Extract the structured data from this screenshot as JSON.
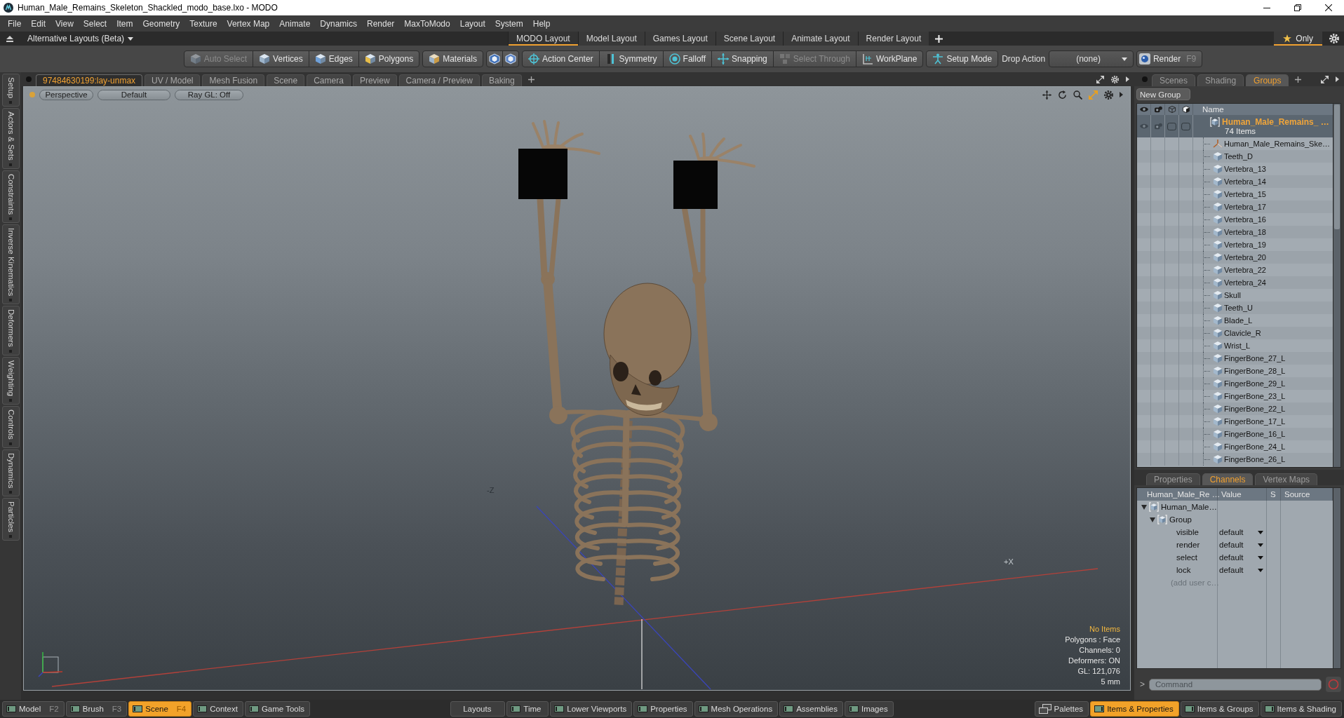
{
  "window": {
    "title": "Human_Male_Remains_Skeleton_Shackled_modo_base.lxo - MODO"
  },
  "menu": [
    "File",
    "Edit",
    "View",
    "Select",
    "Item",
    "Geometry",
    "Texture",
    "Vertex Map",
    "Animate",
    "Dynamics",
    "Render",
    "MaxToModo",
    "Layout",
    "System",
    "Help"
  ],
  "layout_bar": {
    "switcher": "Alternative Layouts (Beta)",
    "tabs": [
      {
        "label": "MODO Layout",
        "selected": true
      },
      {
        "label": "Model Layout",
        "selected": false
      },
      {
        "label": "Games Layout",
        "selected": false
      },
      {
        "label": "Scene Layout",
        "selected": false
      },
      {
        "label": "Animate Layout",
        "selected": false
      },
      {
        "label": "Render Layout",
        "selected": false
      }
    ],
    "filter": {
      "label": "Only",
      "selected": true
    }
  },
  "toolbar": {
    "groups": [
      [
        {
          "kind": "labeled",
          "label": "Auto Select",
          "disabled": true
        },
        {
          "kind": "labeled",
          "label": "Vertices",
          "disabled": false
        },
        {
          "kind": "labeled",
          "label": "Edges",
          "disabled": false
        },
        {
          "kind": "labeled",
          "label": "Polygons",
          "disabled": false
        }
      ],
      [
        {
          "kind": "labeled",
          "label": "Materials",
          "disabled": false
        }
      ],
      [
        {
          "kind": "icon",
          "disabled": false
        },
        {
          "kind": "icon",
          "disabled": false
        }
      ],
      [
        {
          "kind": "labeled",
          "label": "Action Center",
          "disabled": false
        },
        {
          "kind": "labeled",
          "label": "Symmetry",
          "disabled": false
        },
        {
          "kind": "labeled",
          "label": "Falloff",
          "disabled": false
        },
        {
          "kind": "labeled",
          "label": "Snapping",
          "disabled": false
        },
        {
          "kind": "labeled",
          "label": "Select Through",
          "disabled": true
        },
        {
          "kind": "labeled",
          "label": "WorkPlane",
          "disabled": false
        }
      ],
      [
        {
          "kind": "labeled",
          "label": "Setup Mode",
          "disabled": false
        }
      ]
    ],
    "drop_action": {
      "label": "Drop Action",
      "value": "(none)"
    },
    "render": {
      "label": "Render",
      "shortcut": "F9"
    }
  },
  "side_tabs": [
    "Setup",
    "Actors & Sets",
    "Constraints",
    "Inverse Kinematics",
    "Deformers",
    "Weighting",
    "Controls",
    "Dynamics",
    "Particles"
  ],
  "viewport_tabs": [
    {
      "label": "97484630199:lay-unmax",
      "selected": true
    },
    {
      "label": "UV / Model",
      "selected": false
    },
    {
      "label": "Mesh Fusion",
      "selected": false
    },
    {
      "label": "Scene",
      "selected": false
    },
    {
      "label": "Camera",
      "selected": false
    },
    {
      "label": "Preview",
      "selected": false
    },
    {
      "label": "Camera / Preview",
      "selected": false
    },
    {
      "label": "Baking",
      "selected": false
    }
  ],
  "viewport": {
    "view": "Perspective",
    "style": "Default",
    "ray_gl": "Ray GL: Off",
    "axis_labels": [
      "-Z",
      "+X"
    ],
    "info": {
      "selection": "No Items",
      "lines": [
        "Polygons : Face",
        "Channels: 0",
        "Deformers: ON",
        "GL: 121,076",
        "5 mm"
      ]
    }
  },
  "groups_panel": {
    "tabs": [
      {
        "label": "Scenes",
        "selected": false
      },
      {
        "label": "Shading",
        "selected": false
      },
      {
        "label": "Groups",
        "selected": true
      }
    ],
    "new_group": "New Group",
    "name_column": "Name",
    "group": {
      "name": "Human_Male_Remains_ …",
      "count": "74 Items",
      "children": [
        {
          "name": "Human_Male_Remains_Ske…",
          "kind": "locator"
        },
        {
          "name": "Teeth_D",
          "kind": "mesh"
        },
        {
          "name": "Vertebra_13",
          "kind": "mesh"
        },
        {
          "name": "Vertebra_14",
          "kind": "mesh"
        },
        {
          "name": "Vertebra_15",
          "kind": "mesh"
        },
        {
          "name": "Vertebra_17",
          "kind": "mesh"
        },
        {
          "name": "Vertebra_16",
          "kind": "mesh"
        },
        {
          "name": "Vertebra_18",
          "kind": "mesh"
        },
        {
          "name": "Vertebra_19",
          "kind": "mesh"
        },
        {
          "name": "Vertebra_20",
          "kind": "mesh"
        },
        {
          "name": "Vertebra_22",
          "kind": "mesh"
        },
        {
          "name": "Vertebra_24",
          "kind": "mesh"
        },
        {
          "name": "Skull",
          "kind": "mesh"
        },
        {
          "name": "Teeth_U",
          "kind": "mesh"
        },
        {
          "name": "Blade_L",
          "kind": "mesh"
        },
        {
          "name": "Clavicle_R",
          "kind": "mesh"
        },
        {
          "name": "Wrist_L",
          "kind": "mesh"
        },
        {
          "name": "FingerBone_27_L",
          "kind": "mesh"
        },
        {
          "name": "FingerBone_28_L",
          "kind": "mesh"
        },
        {
          "name": "FingerBone_29_L",
          "kind": "mesh"
        },
        {
          "name": "FingerBone_23_L",
          "kind": "mesh"
        },
        {
          "name": "FingerBone_22_L",
          "kind": "mesh"
        },
        {
          "name": "FingerBone_17_L",
          "kind": "mesh"
        },
        {
          "name": "FingerBone_16_L",
          "kind": "mesh"
        },
        {
          "name": "FingerBone_24_L",
          "kind": "mesh"
        },
        {
          "name": "FingerBone_26_L",
          "kind": "mesh"
        }
      ]
    }
  },
  "channels_panel": {
    "tabs": [
      {
        "label": "Properties",
        "selected": false
      },
      {
        "label": "Channels",
        "selected": true
      },
      {
        "label": "Vertex Maps",
        "selected": false
      }
    ],
    "columns": [
      "Human_Male_Re …",
      "Value",
      "S",
      "Source"
    ],
    "tree": {
      "name": "Human_Male…",
      "expanded": true,
      "children": [
        {
          "name": "Group",
          "expanded": true,
          "children": [
            {
              "name": "visible",
              "kind": "channel",
              "value": "default"
            },
            {
              "name": "render",
              "kind": "channel",
              "value": "default"
            },
            {
              "name": "select",
              "kind": "channel",
              "value": "default"
            },
            {
              "name": "lock",
              "kind": "channel",
              "value": "default"
            },
            {
              "name": "(add user c…",
              "kind": "add"
            }
          ]
        }
      ]
    }
  },
  "command": {
    "prompt": ">",
    "placeholder": "Command"
  },
  "bottom_bar": {
    "left": [
      {
        "label": "Model",
        "shortcut": "F2",
        "selected": false
      },
      {
        "label": "Brush",
        "shortcut": "F3",
        "selected": false
      },
      {
        "label": "Scene",
        "shortcut": "F4",
        "selected": true
      },
      {
        "label": "Context",
        "selected": false
      },
      {
        "label": "Game Tools",
        "selected": false
      }
    ],
    "center": [
      {
        "kind": "text",
        "label": "Layouts",
        "selected": false
      },
      {
        "kind": "panel",
        "label": "Time",
        "selected": false
      },
      {
        "kind": "panel",
        "label": "Lower Viewports",
        "selected": false
      },
      {
        "kind": "panel",
        "label": "Properties",
        "selected": false
      },
      {
        "kind": "panel",
        "label": "Mesh Operations",
        "selected": false
      },
      {
        "kind": "panel",
        "label": "Assemblies",
        "selected": false
      },
      {
        "kind": "panel",
        "label": "Images",
        "selected": false
      }
    ],
    "right": [
      {
        "kind": "palettes",
        "label": "Palettes",
        "selected": false
      },
      {
        "kind": "panel",
        "label": "Items & Properties",
        "selected": true
      },
      {
        "kind": "panel",
        "label": "Items & Groups",
        "selected": false
      },
      {
        "kind": "panel",
        "label": "Items & Shading",
        "selected": false
      }
    ]
  }
}
